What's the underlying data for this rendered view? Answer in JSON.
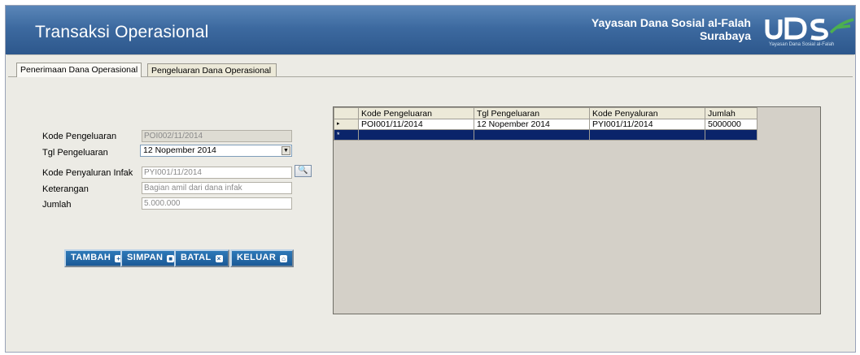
{
  "header": {
    "title": "Transaksi Operasional",
    "org_line1": "Yayasan Dana Sosial al-Falah",
    "org_line2": "Surabaya",
    "logo_text": "YDSF",
    "logo_subtext": "Yayasan Dana Sosial al-Falah"
  },
  "tabs": [
    {
      "label": "Penerimaan Dana Operasional",
      "active": true
    },
    {
      "label": "Pengeluaran Dana Operasional",
      "active": false
    }
  ],
  "form": {
    "kode_pengeluaran": {
      "label": "Kode Pengeluaran",
      "value": "POI002/11/2014"
    },
    "tgl_pengeluaran": {
      "label": "Tgl Pengeluaran",
      "value": "12 Nopember 2014"
    },
    "kode_penyaluran": {
      "label": "Kode Penyaluran Infak",
      "value": "PYI001/11/2014"
    },
    "keterangan": {
      "label": "Keterangan",
      "value": "Bagian amil dari dana infak"
    },
    "jumlah": {
      "label": "Jumlah",
      "value": "5.000.000"
    }
  },
  "buttons": {
    "tambah": "TAMBAH",
    "simpan": "SIMPAN",
    "batal": "BATAL",
    "keluar": "KELUAR"
  },
  "grid": {
    "columns": [
      "Kode Pengeluaran",
      "Tgl Pengeluaran",
      "Kode Penyaluran",
      "Jumlah"
    ],
    "rows": [
      [
        "POI001/11/2014",
        "12 Nopember 2014",
        "PYI001/11/2014",
        "5000000"
      ]
    ],
    "new_row_marker": "*",
    "current_row_marker": "▸"
  },
  "colors": {
    "header_bg": "#3d6aa0",
    "button_bg": "#1b5a97",
    "grid_selection": "#0a246a"
  }
}
